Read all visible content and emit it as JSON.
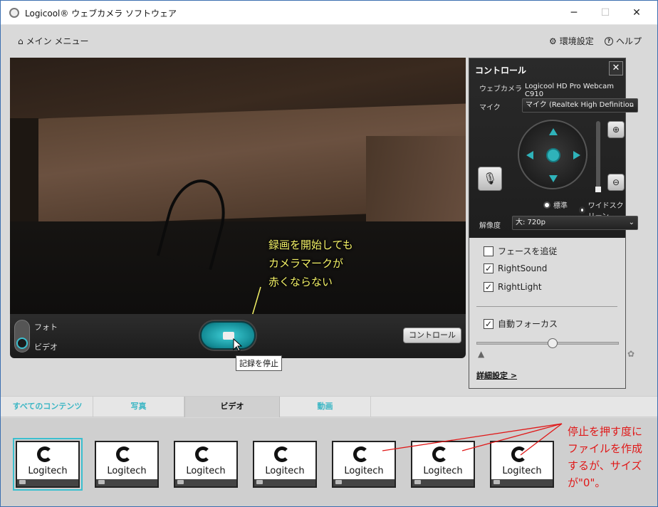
{
  "window": {
    "title": "Logicool® ウェブカメラ ソフトウェア",
    "minimize": "─",
    "maximize": "☐",
    "close": "✕"
  },
  "menubar": {
    "main_menu": "メイン メニュー",
    "settings": "環境設定",
    "help": "ヘルプ"
  },
  "preview": {
    "annotation_lines": [
      "録画を開始しても",
      "カメラマークが",
      "赤くならない"
    ]
  },
  "capture_bar": {
    "mode_photo": "フォト",
    "mode_video": "ビデオ",
    "control_button": "コントロール",
    "tooltip": "記録を停止"
  },
  "control_panel": {
    "title": "コントロール",
    "close": "✕",
    "webcam_label": "ウェブカメラ",
    "webcam_value": "Logicool HD Pro Webcam C910",
    "mic_label": "マイク",
    "mic_value": "マイク (Realtek High Definition",
    "radio_standard": "標準",
    "radio_wide": "ワイドスクリーン",
    "resolution_label": "解像度",
    "resolution_value": "大: 720p",
    "face_tracking": "フェースを追従",
    "right_sound": "RightSound",
    "right_light": "RightLight",
    "autofocus": "自動フォーカス",
    "advanced": "詳細設定 >"
  },
  "tabs": [
    "すべてのコンテンツ",
    "写真",
    "ビデオ",
    "動画"
  ],
  "thumbnails": [
    "Logitech",
    "Logitech",
    "Logitech",
    "Logitech",
    "Logitech",
    "Logitech",
    "Logitech"
  ],
  "note_lines": [
    "停止を押す度に",
    "ファイルを作成",
    "するが、サイズ",
    "が\"0\"。"
  ]
}
